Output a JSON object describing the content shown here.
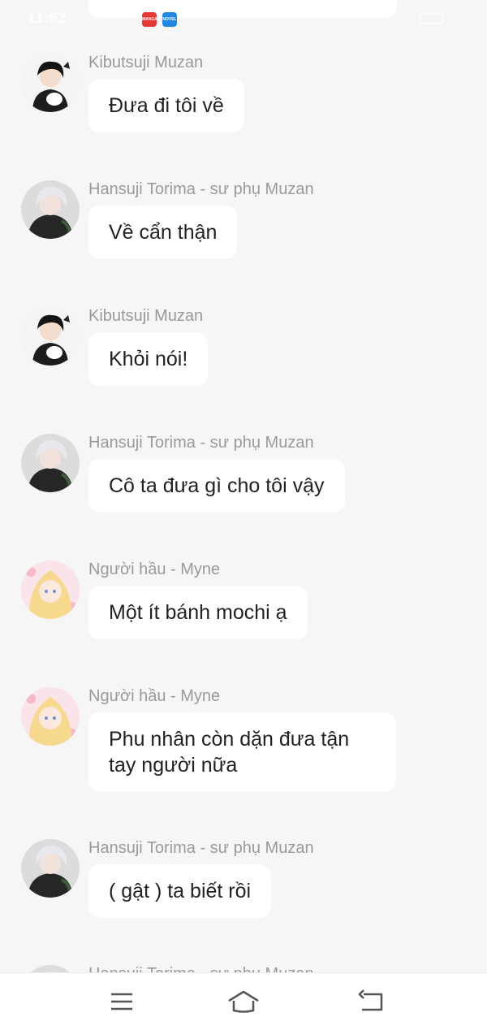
{
  "status_bar": {
    "time": "11:52",
    "app_icons": [
      {
        "name": "manga-toon-icon",
        "label": "MANGA TOON",
        "color": "#e53935"
      },
      {
        "name": "novel-toon-icon",
        "label": "NOVEL TOON",
        "color": "#1e88e5"
      }
    ]
  },
  "messages": [
    {
      "sender": "Kibutsuji Muzan",
      "text": "Đưa đi tôi về",
      "avatar": "muzan"
    },
    {
      "sender": "Hansuji Torima - sư phụ Muzan",
      "text": "Về cẩn thận",
      "avatar": "torima"
    },
    {
      "sender": "Kibutsuji Muzan",
      "text": "Khỏi nói!",
      "avatar": "muzan"
    },
    {
      "sender": "Hansuji Torima - sư phụ Muzan",
      "text": "Cô ta đưa gì cho tôi vậy",
      "avatar": "torima"
    },
    {
      "sender": "Người hầu - Myne",
      "text": "Một ít bánh mochi ạ",
      "avatar": "myne"
    },
    {
      "sender": "Người hầu - Myne",
      "text": "Phu nhân còn dặn đưa tận\ntay người nữa",
      "avatar": "myne"
    },
    {
      "sender": "Hansuji Torima - sư phụ Muzan",
      "text": "( gật ) ta biết rồi",
      "avatar": "torima"
    },
    {
      "sender": "Hansuji Torima - sư phụ Muzan",
      "text": "",
      "avatar": "torima"
    }
  ],
  "nav_bar": {
    "buttons": [
      "menu-icon",
      "home-icon",
      "back-icon"
    ]
  },
  "colors": {
    "background": "#f6f6f6",
    "bubble": "#ffffff",
    "sender_name": "#9a9a9a",
    "message_text": "#222222"
  }
}
